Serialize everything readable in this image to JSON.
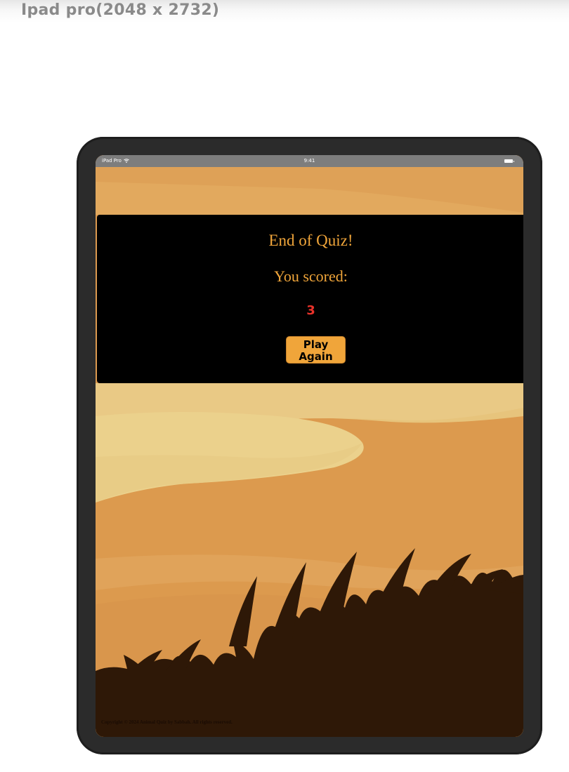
{
  "header": {
    "device_label": "Ipad pro(2048 x 2732)"
  },
  "status_bar": {
    "carrier": "iPad Pro",
    "wifi_icon": "wifi-icon",
    "time": "9:41",
    "battery_icon": "battery-icon"
  },
  "quiz": {
    "title": "End of Quiz!",
    "score_label": "You scored:",
    "score_value": "3",
    "play_again_line1": "Play",
    "play_again_line2": "Again"
  },
  "footer": {
    "copyright": "Copyright © 2024 Animal Quiz by Sabbah. All rights reserved."
  },
  "colors": {
    "accent": "#f0a53a",
    "score": "#e8322a",
    "panel": "#000000",
    "sand": "#dc9a4e",
    "sand_light": "#ebd18c",
    "grass": "#2e1807"
  }
}
